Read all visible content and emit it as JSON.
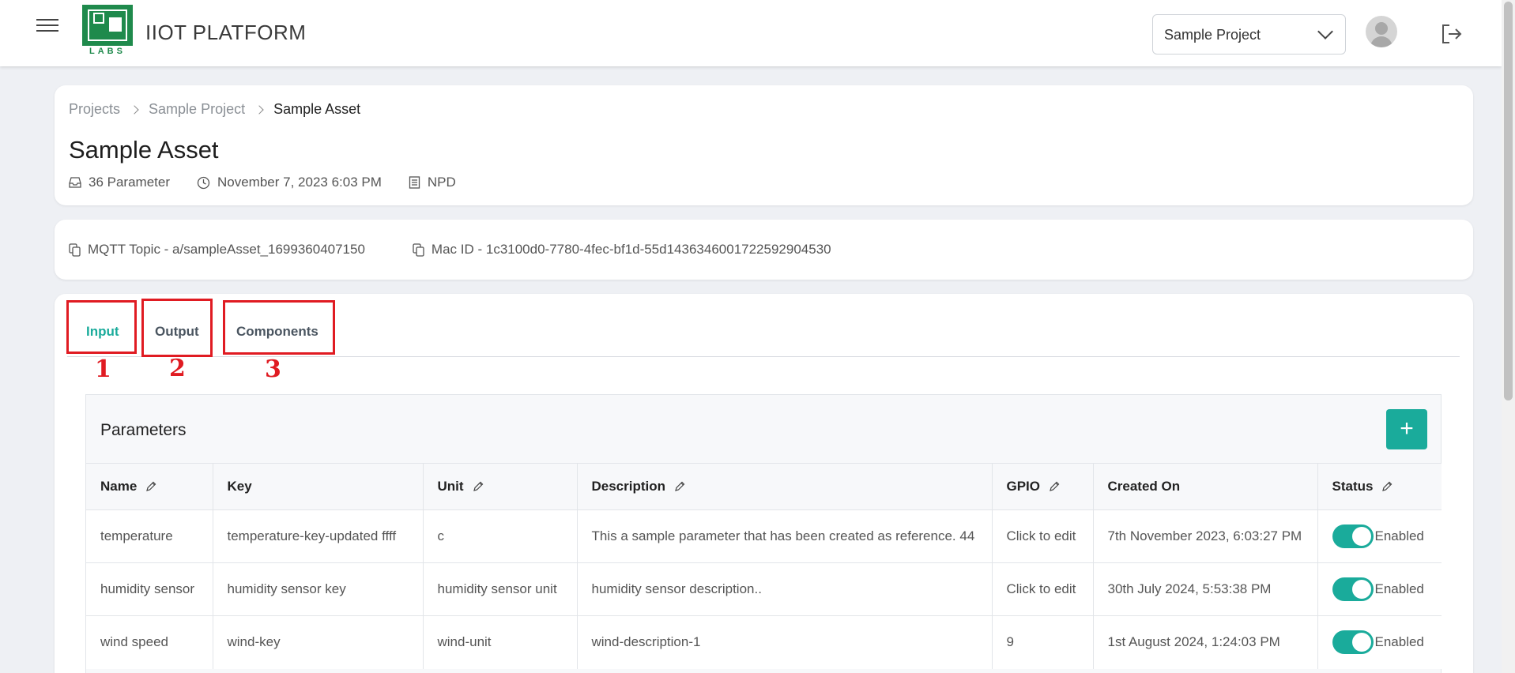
{
  "header": {
    "brand": "IIOT PLATFORM",
    "logo_text": "LABS",
    "project_selected": "Sample Project"
  },
  "breadcrumb": [
    "Projects",
    "Sample Project",
    "Sample Asset"
  ],
  "asset": {
    "title": "Sample Asset",
    "parameters": "36 Parameter",
    "created": "November 7, 2023 6:03 PM",
    "category": "NPD",
    "mqtt_topic": "MQTT Topic - a/sampleAsset_1699360407150",
    "mac_id": "Mac ID - 1c3100d0-7780-4fec-bf1d-55d1436346001722592904530"
  },
  "tabs": [
    "Input",
    "Output",
    "Components"
  ],
  "annotations": [
    "1",
    "2",
    "3"
  ],
  "parameters_panel": {
    "title": "Parameters",
    "add_label": "+",
    "columns": [
      "Name",
      "Key",
      "Unit",
      "Description",
      "GPIO",
      "Created On",
      "Status"
    ],
    "rows": [
      {
        "name": "temperature",
        "key": "temperature-key-updated ffff",
        "unit": "c",
        "description": "This a sample parameter that has been created as reference. 44",
        "gpio": "Click to edit",
        "created": "7th November 2023, 6:03:27 PM",
        "status": "Enabled"
      },
      {
        "name": "humidity sensor",
        "key": "humidity sensor key",
        "unit": "humidity sensor unit",
        "description": "humidity sensor description..",
        "gpio": "Click to edit",
        "created": "30th July 2024, 5:53:38 PM",
        "status": "Enabled"
      },
      {
        "name": "wind speed",
        "key": "wind-key",
        "unit": "wind-unit",
        "description": "wind-description-1",
        "gpio": "9",
        "created": "1st August 2024, 1:24:03 PM",
        "status": "Enabled"
      }
    ]
  },
  "colors": {
    "accent": "#1aab9b",
    "annotation": "#e01b22",
    "brand_green": "#1f8a4c"
  }
}
